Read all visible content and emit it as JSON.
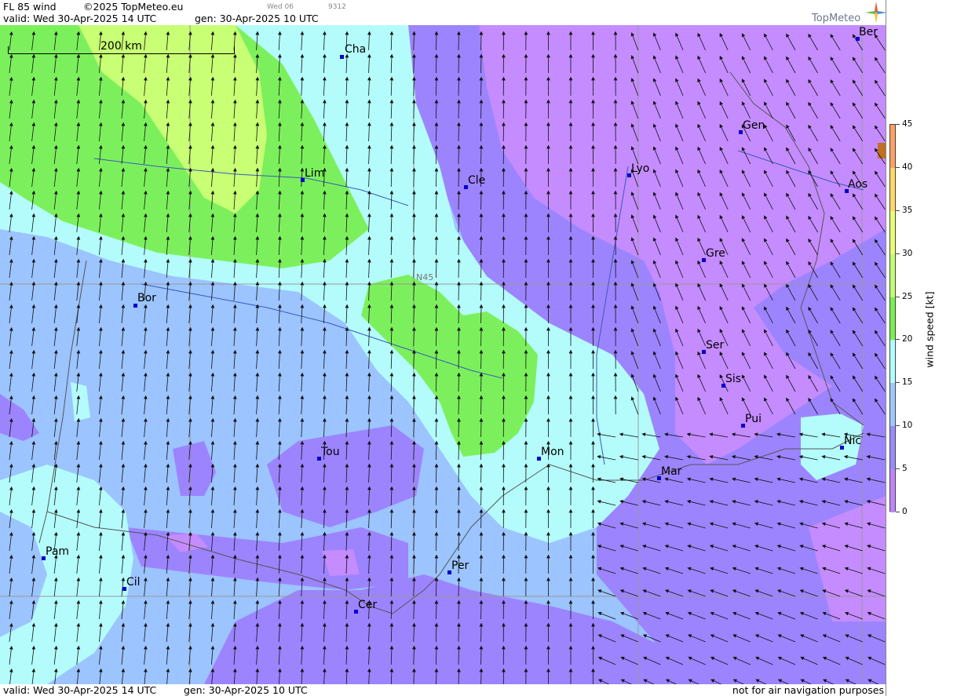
{
  "header": {
    "product": "FL 85 wind",
    "copyright": "©2025 TopMeteo.eu",
    "valid": "valid:  Wed  30-Apr-2025  14 UTC",
    "gen": "gen: 30-Apr-2025 10 UTC",
    "day_tag": "Wed 06",
    "code_tag": "9312"
  },
  "footer": {
    "valid": "valid:  Wed  30-Apr-2025  14 UTC",
    "gen": "gen: 30-Apr-2025 10 UTC",
    "disclaimer": "not for air navigation purposes"
  },
  "logo": {
    "text": "TopMeteo",
    "icon": "compass-star-icon"
  },
  "map": {
    "scale_label": "200 km",
    "grid_label": "N45",
    "cities": [
      {
        "name": "Cha"
      },
      {
        "name": "Ber"
      },
      {
        "name": "Gen"
      },
      {
        "name": "Lim"
      },
      {
        "name": "Cle"
      },
      {
        "name": "Lyo"
      },
      {
        "name": "Aos"
      },
      {
        "name": "Gre"
      },
      {
        "name": "Bor"
      },
      {
        "name": "Ser"
      },
      {
        "name": "Sis"
      },
      {
        "name": "Pui"
      },
      {
        "name": "Nic"
      },
      {
        "name": "Tou"
      },
      {
        "name": "Mon"
      },
      {
        "name": "Mar"
      },
      {
        "name": "Pam"
      },
      {
        "name": "Per"
      },
      {
        "name": "Cil"
      },
      {
        "name": "Cer"
      }
    ]
  },
  "legend": {
    "title": "wind speed [kt]",
    "ticks": [
      "45",
      "40",
      "35",
      "30",
      "25",
      "20",
      "15",
      "10",
      "5",
      "0"
    ],
    "colors": [
      "#f47a5a",
      "#ffa060",
      "#ffd860",
      "#e8ff70",
      "#c0ff70",
      "#78f050",
      "#b0ffff",
      "#9cc8ff",
      "#9a8cff",
      "#c084ff"
    ]
  },
  "colors": {
    "purple_light": "#c58cff",
    "purple": "#9c84ff",
    "blue": "#9cc4ff",
    "cyan": "#b4fcfc",
    "green": "#7cf05c",
    "yellowgreen": "#c8ff74"
  }
}
